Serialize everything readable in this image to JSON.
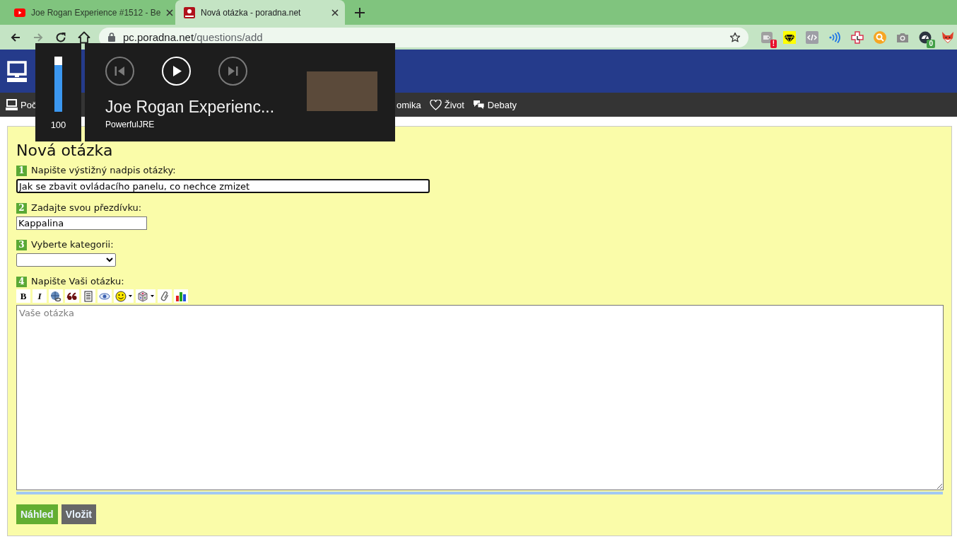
{
  "browser": {
    "tabs": [
      {
        "title": "Joe Rogan Experience #1512 - Be",
        "kind": "video",
        "selected": false
      },
      {
        "title": "Nová otázka - poradna.net",
        "kind": "site",
        "selected": true
      }
    ],
    "nav_buttons": [
      {
        "kind": "back",
        "disabled": false
      },
      {
        "kind": "forward",
        "disabled": true
      },
      {
        "kind": "reload",
        "disabled": false
      },
      {
        "kind": "home",
        "disabled": false
      }
    ],
    "address": {
      "host": "pc.poradna.net",
      "path": "/questions/add"
    },
    "extensions": [
      {
        "kind": "tag",
        "badge": "!",
        "color": "#e8112d"
      },
      {
        "kind": "diamond"
      },
      {
        "kind": "code"
      },
      {
        "kind": "waves"
      },
      {
        "kind": "cross"
      },
      {
        "kind": "search"
      },
      {
        "kind": "camera"
      },
      {
        "kind": "gauge",
        "badge": "0",
        "color": "#43a047"
      },
      {
        "kind": "fox"
      }
    ]
  },
  "site": {
    "nav": [
      {
        "label": "Poč",
        "kind": "computer"
      },
      {
        "label": "omika",
        "kind": "none"
      },
      {
        "label": "Život",
        "kind": "heart"
      },
      {
        "label": "Debaty",
        "kind": "bubbles"
      }
    ]
  },
  "form": {
    "heading": "Nová otázka",
    "fields": [
      {
        "number": "1",
        "label": "Napište výstižný nadpis otázky:",
        "kind": "text",
        "value": "Jak se zbavit ovládacího panelu, co nechce zmizet",
        "focused": true
      },
      {
        "number": "2",
        "label": "Zadajte svou přezdívku:",
        "kind": "short_text",
        "value": "Kappalina",
        "focused": false
      },
      {
        "number": "3",
        "label": "Vyberte kategorii:",
        "kind": "select",
        "focused": false
      },
      {
        "number": "4",
        "label": "Napište Vaši otázku:",
        "kind": "editor",
        "focused": false,
        "placeholder": "Vaše otázka",
        "toolbar": [
          {
            "kind": "bold",
            "label": "B",
            "dropdown": false
          },
          {
            "kind": "italic",
            "label": "I",
            "dropdown": false
          },
          {
            "kind": "globe",
            "dropdown": false
          },
          {
            "kind": "quote",
            "dropdown": false
          },
          {
            "kind": "document",
            "dropdown": false
          },
          {
            "kind": "eye",
            "dropdown": false
          },
          {
            "kind": "smiley",
            "dropdown": true
          },
          {
            "kind": "dice",
            "dropdown": true
          },
          {
            "kind": "paperclip",
            "dropdown": false
          },
          {
            "kind": "chart",
            "dropdown": false
          }
        ]
      }
    ],
    "buttons": [
      {
        "label": "Náhled",
        "kind": "primary"
      },
      {
        "label": "Vložit",
        "kind": "secondary"
      }
    ]
  },
  "media_overlay": {
    "volume": {
      "level": 1,
      "reading": "100"
    },
    "controls": [
      {
        "kind": "previous",
        "disabled": true
      },
      {
        "kind": "play",
        "disabled": false
      },
      {
        "kind": "next",
        "disabled": true
      }
    ],
    "title": "Joe Rogan Experienc...",
    "artist": "PowerfulJRE"
  }
}
